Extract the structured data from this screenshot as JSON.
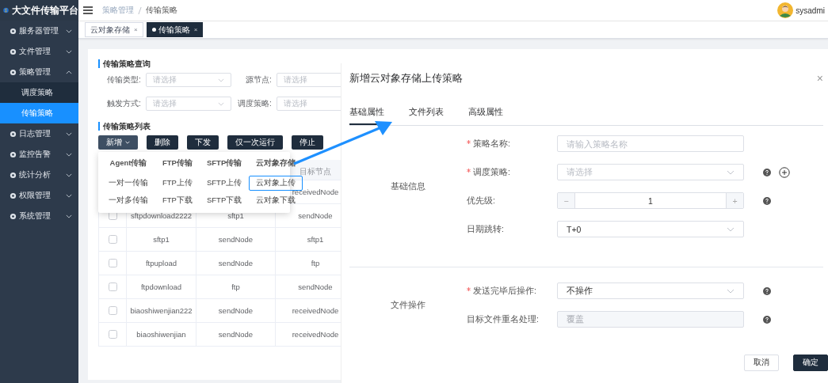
{
  "app": {
    "title": "大文件传输平台"
  },
  "sidebar": {
    "items": [
      {
        "label": "服务器管理",
        "expanded": false
      },
      {
        "label": "文件管理",
        "expanded": false
      },
      {
        "label": "策略管理",
        "expanded": true,
        "children": [
          {
            "label": "调度策略",
            "selected": false
          },
          {
            "label": "传输策略",
            "selected": true
          }
        ]
      },
      {
        "label": "日志管理",
        "expanded": false
      },
      {
        "label": "监控告警",
        "expanded": false
      },
      {
        "label": "统计分析",
        "expanded": false
      },
      {
        "label": "权限管理",
        "expanded": false
      },
      {
        "label": "系统管理",
        "expanded": false
      }
    ]
  },
  "breadcrumb": [
    "策略管理",
    "传输策略"
  ],
  "user": {
    "name": "sysadmi"
  },
  "page_tabs": [
    {
      "label": "云对象存储",
      "selected": false,
      "close": "×"
    },
    {
      "label": "传输策略",
      "selected": true,
      "close": "×"
    }
  ],
  "query": {
    "title": "传输策略查询",
    "fields": [
      {
        "label": "传输类型:",
        "placeholder": "请选择",
        "kind": "select"
      },
      {
        "label": "源节点:",
        "placeholder": "请选择",
        "kind": "input"
      },
      {
        "label": "触发方式:",
        "placeholder": "请选择",
        "kind": "select"
      },
      {
        "label": "调度策略:",
        "placeholder": "请选择",
        "kind": "input"
      }
    ]
  },
  "list": {
    "title": "传输策略列表",
    "buttons": [
      {
        "label": "新增",
        "kind": "dropdown"
      },
      {
        "label": "删除",
        "kind": "plain"
      },
      {
        "label": "下发",
        "kind": "plain"
      },
      {
        "label": "仅一次运行",
        "kind": "plain"
      },
      {
        "label": "停止",
        "kind": "plain"
      }
    ],
    "menu": [
      {
        "heading": "Agent传输",
        "items": [
          {
            "label": "一对一传输",
            "selected": false
          },
          {
            "label": "一对多传输",
            "selected": false
          }
        ]
      },
      {
        "heading": "FTP传输",
        "items": [
          {
            "label": "FTP上传",
            "selected": false
          },
          {
            "label": "FTP下载",
            "selected": false
          }
        ]
      },
      {
        "heading": "SFTP传输",
        "items": [
          {
            "label": "SFTP上传",
            "selected": false
          },
          {
            "label": "SFTP下载",
            "selected": false
          }
        ]
      },
      {
        "heading": "云对象存储",
        "items": [
          {
            "label": "云对象上传",
            "selected": true
          },
          {
            "label": "云对象下载",
            "selected": false
          }
        ]
      }
    ],
    "table": {
      "columns": [
        "目标节点"
      ],
      "rows": [
        {
          "cells": [
            "receivedNode"
          ]
        },
        {
          "cells": [
            "sftpdownload2222",
            "sftp1",
            "sendNode"
          ],
          "checked": false
        },
        {
          "cells": [
            "sftp1",
            "sendNode",
            "sftp1"
          ],
          "checked": false
        },
        {
          "cells": [
            "ftpupload",
            "sendNode",
            "ftp"
          ],
          "checked": false
        },
        {
          "cells": [
            "ftpdownload",
            "ftp",
            "sendNode"
          ],
          "checked": false
        },
        {
          "cells": [
            "biaoshiwenjian222",
            "sendNode",
            "receivedNode"
          ],
          "checked": false
        },
        {
          "cells": [
            "biaoshiwenjian",
            "sendNode",
            "receivedNode"
          ],
          "checked": false
        }
      ]
    }
  },
  "dialog": {
    "title": "新增云对象存储上传策略",
    "close": "×",
    "tabs": [
      {
        "label": "基础属性",
        "selected": true
      },
      {
        "label": "文件列表",
        "selected": false
      },
      {
        "label": "高级属性",
        "selected": false
      }
    ],
    "sections": [
      {
        "title": "基础信息",
        "fields": [
          {
            "label": "策略名称:",
            "required": true,
            "kind": "input",
            "placeholder": "请输入策略名称",
            "help": false,
            "add": false
          },
          {
            "label": "调度策略:",
            "required": true,
            "kind": "select",
            "placeholder": "请选择",
            "help": true,
            "add": true
          },
          {
            "label": "优先级:",
            "required": false,
            "kind": "number",
            "value": "1",
            "minus": "−",
            "plus": "+",
            "help": true,
            "add": false
          },
          {
            "label": "日期跳转:",
            "required": false,
            "kind": "select",
            "value": "T+0",
            "help": false,
            "add": false
          }
        ]
      },
      {
        "title": "文件操作",
        "fields": [
          {
            "label": "发送完毕后操作:",
            "required": true,
            "kind": "select",
            "value": "不操作",
            "help": true,
            "add": false
          },
          {
            "label": "目标文件重名处理:",
            "required": false,
            "kind": "disabled",
            "value": "覆盖",
            "help": true,
            "add": false
          }
        ]
      }
    ],
    "buttons": [
      {
        "label": "取消",
        "kind": "plain"
      },
      {
        "label": "确定",
        "kind": "primary"
      }
    ]
  }
}
